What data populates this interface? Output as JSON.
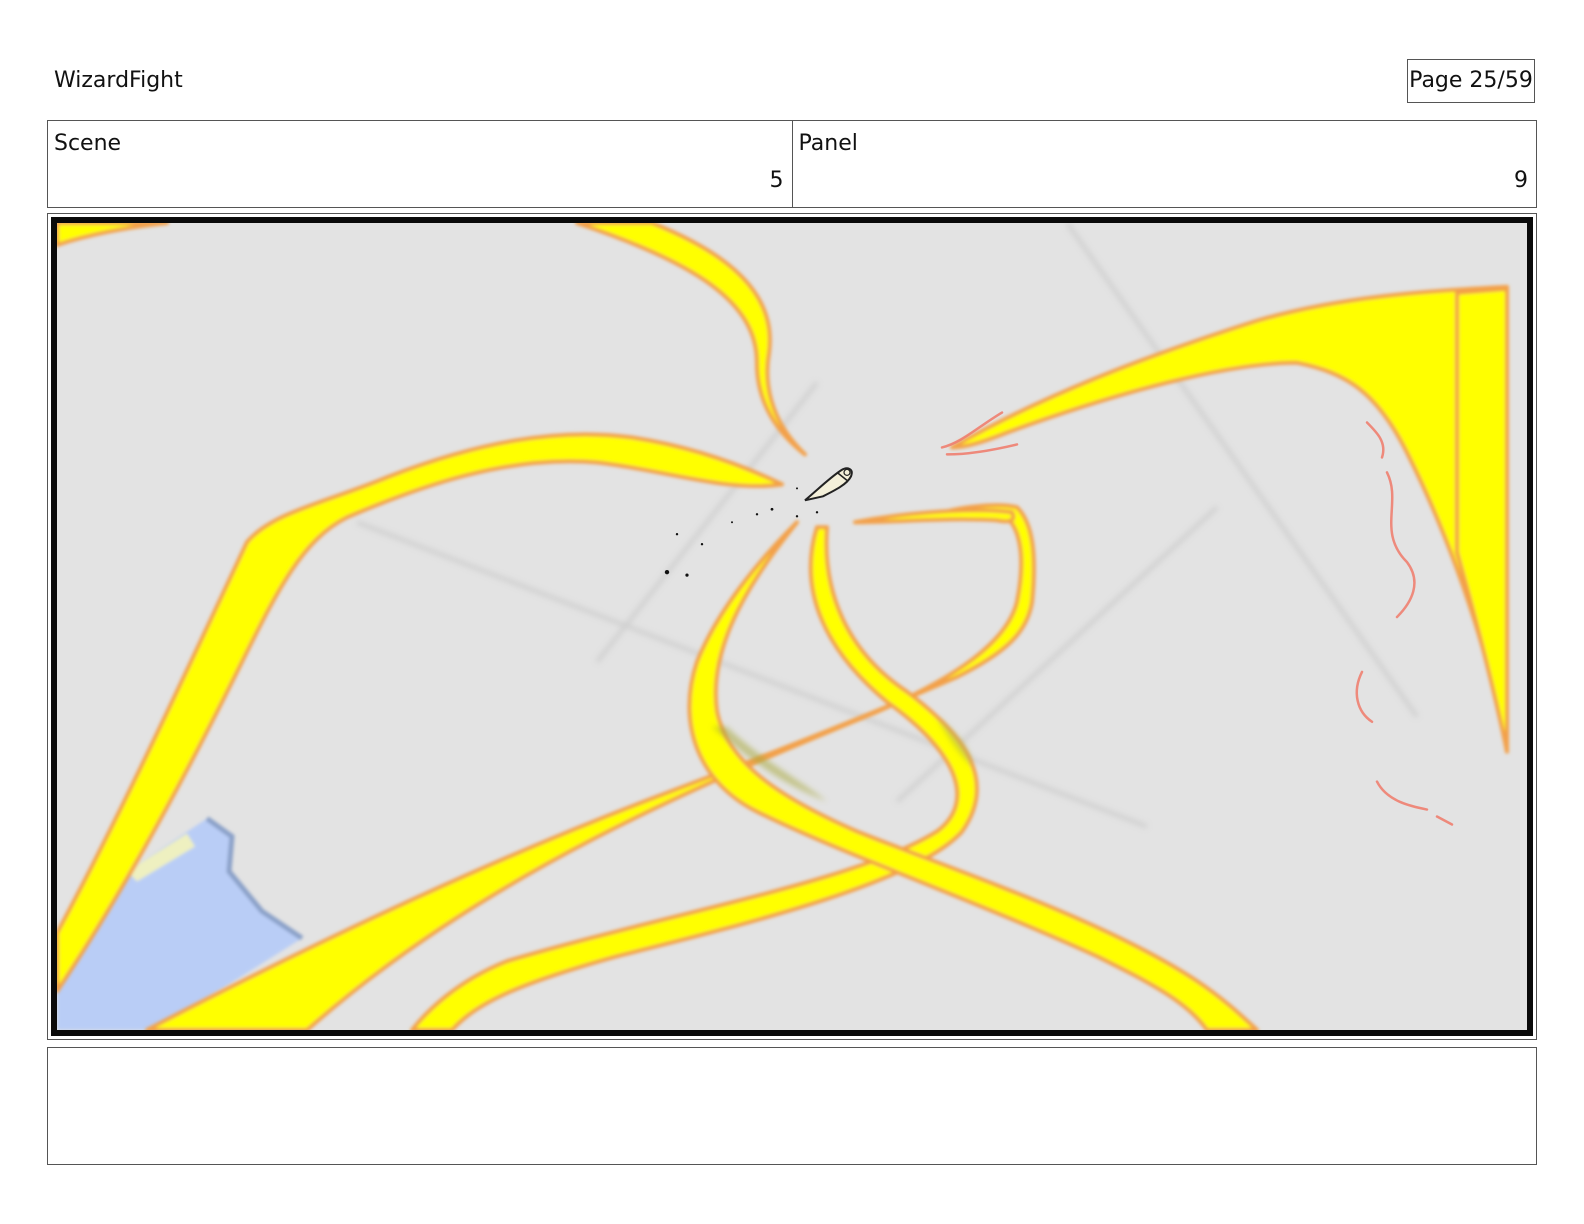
{
  "header": {
    "project_title": "WizardFight",
    "page_label": "Page 25/59"
  },
  "info": {
    "scene_label": "Scene",
    "scene_value": "5",
    "panel_label": "Panel",
    "panel_value": "9"
  },
  "artwork": {
    "description_colors": {
      "background": "#e3e3e3",
      "energy_fill": "#ffff00",
      "energy_edge": "#f3a04a",
      "water": "#b9cdf6",
      "frame": "#0a0a0a"
    }
  },
  "notes": {
    "text": ""
  }
}
